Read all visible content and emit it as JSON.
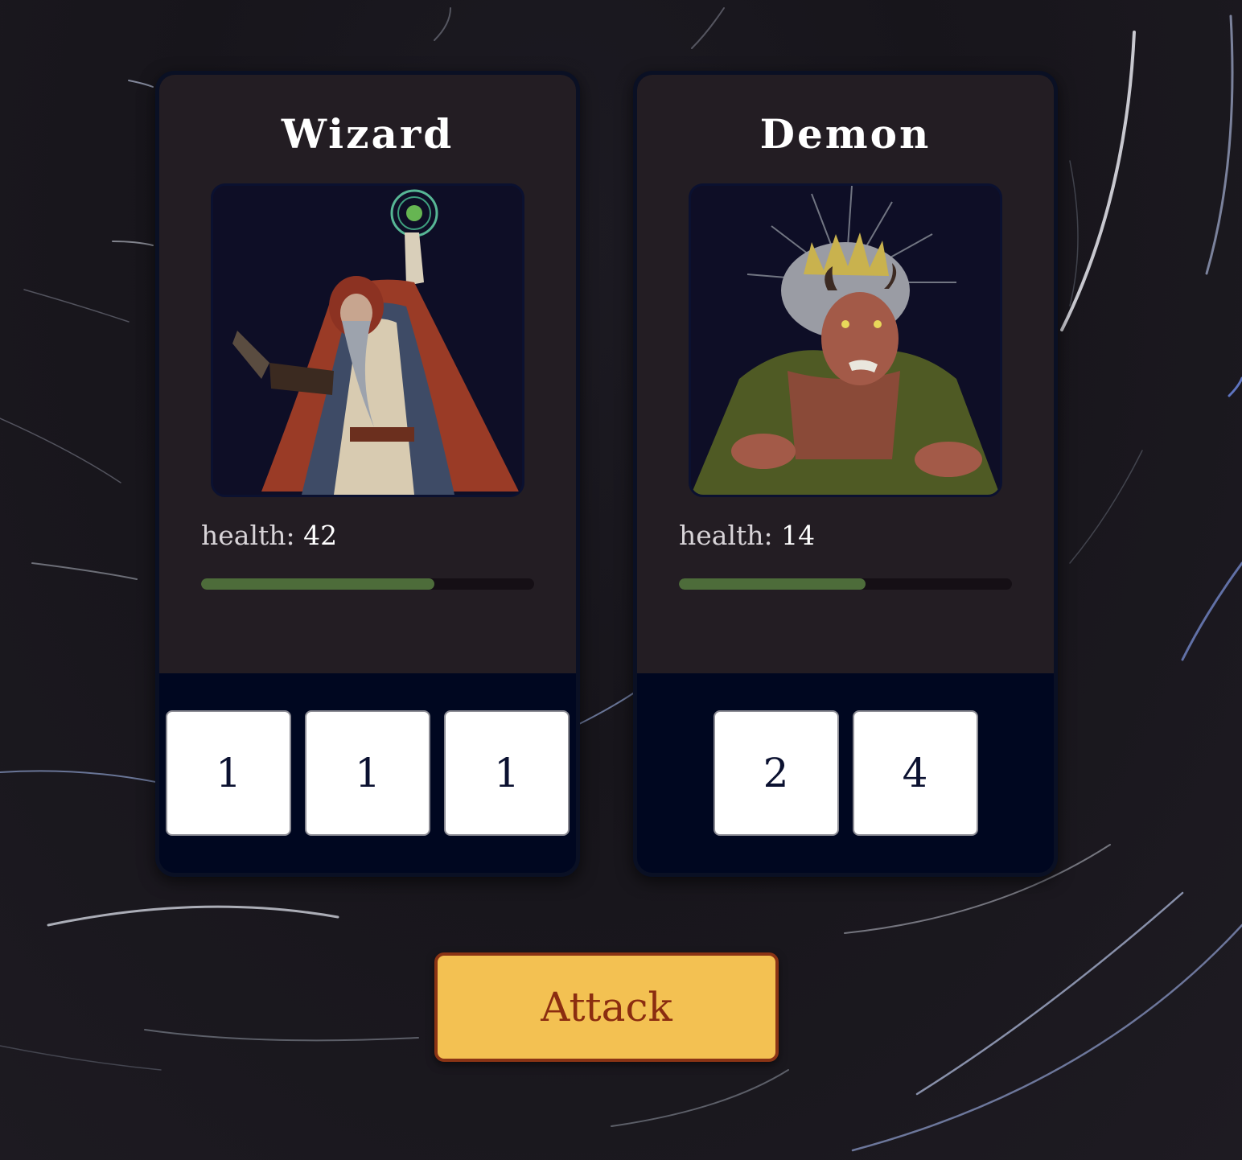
{
  "hero": {
    "name": "Wizard",
    "health_label": "health:",
    "health": "42",
    "health_fraction": 0.7,
    "dice": [
      "1",
      "1",
      "1"
    ],
    "portrait": "wizard-portrait"
  },
  "monster": {
    "name": "Demon",
    "health_label": "health:",
    "health": "14",
    "health_fraction": 0.56,
    "dice": [
      "2",
      "4"
    ],
    "portrait": "demon-portrait"
  },
  "attack_button": {
    "label": "Attack"
  },
  "colors": {
    "card_bg": "#231d23",
    "dice_area_bg": "#000720",
    "health_bar": "#4d6c3a",
    "button_bg": "#f3c152",
    "button_text": "#8b2d10"
  }
}
